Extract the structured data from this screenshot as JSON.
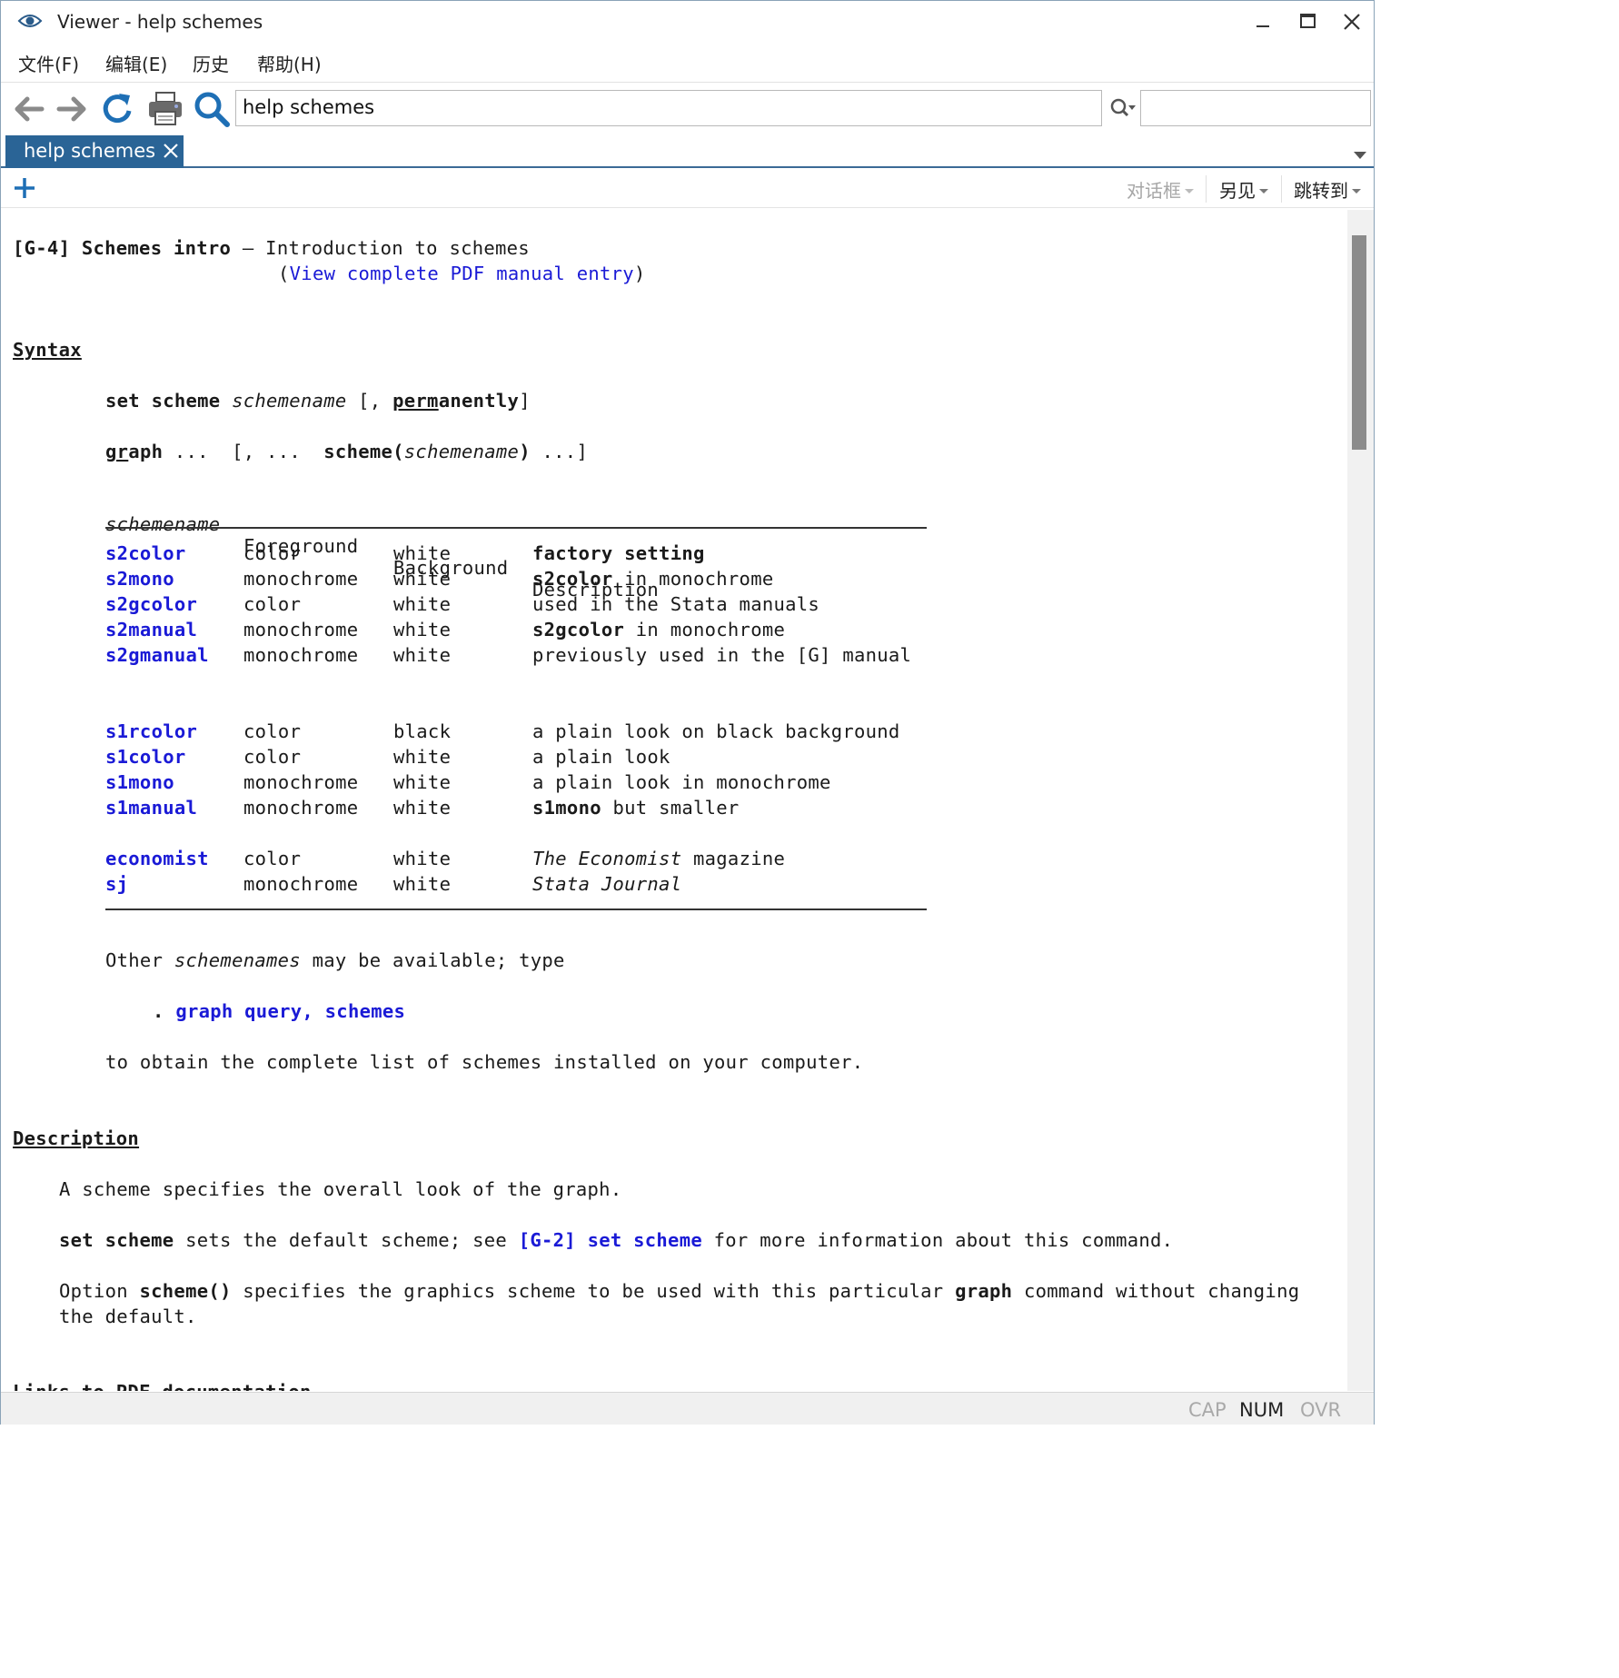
{
  "window": {
    "title": "Viewer - help schemes",
    "icon": "eye-icon"
  },
  "menu": {
    "items": [
      "文件(F)",
      "编辑(E)",
      "历史",
      "帮助(H)"
    ]
  },
  "toolbar": {
    "command_value": "help schemes",
    "find_value": ""
  },
  "tab": {
    "label": "help schemes"
  },
  "subbar": {
    "dialog_label": "对话框",
    "also_see_label": "另见",
    "jump_label": "跳转到"
  },
  "doc": {
    "header_ref": "[G-4] Schemes intro",
    "header_dash": "—",
    "header_title": "Introduction to schemes",
    "pdf_open": "(",
    "pdf_link": "View complete PDF manual entry",
    "pdf_close": ")",
    "syntax_heading": "Syntax",
    "syntax1": {
      "cmd": "set scheme",
      "arg": "schemename",
      "opt_open": "[,",
      "opt_abbr": "perm",
      "opt_rest": "anently",
      "opt_close": "]"
    },
    "syntax2": {
      "abbr": "gr",
      "rest": "aph",
      "dots1": "...",
      "opt_open": "[, ...",
      "fn": "scheme(",
      "fn_arg": "schemename",
      "fn_close": ")",
      "tail": "...]"
    },
    "table_headers": [
      "schemename",
      "Foreground",
      "Background",
      "Description"
    ],
    "table_group1": [
      {
        "name": "s2color",
        "fg": "color",
        "bg": "white",
        "desc_bold": "factory setting",
        "desc": ""
      },
      {
        "name": "s2mono",
        "fg": "monochrome",
        "bg": "white",
        "desc_bold": "s2color",
        "desc": " in monochrome"
      },
      {
        "name": "s2gcolor",
        "fg": "color",
        "bg": "white",
        "desc_bold": "",
        "desc": "used in the Stata manuals"
      },
      {
        "name": "s2manual",
        "fg": "monochrome",
        "bg": "white",
        "desc_bold": "s2gcolor",
        "desc": " in monochrome"
      },
      {
        "name": "s2gmanual",
        "fg": "monochrome",
        "bg": "white",
        "desc_bold": "",
        "desc": "previously used in the [G] manual"
      }
    ],
    "table_group2": [
      {
        "name": "s1rcolor",
        "fg": "color",
        "bg": "black",
        "desc_bold": "",
        "desc": "a plain look on black background"
      },
      {
        "name": "s1color",
        "fg": "color",
        "bg": "white",
        "desc_bold": "",
        "desc": "a plain look"
      },
      {
        "name": "s1mono",
        "fg": "monochrome",
        "bg": "white",
        "desc_bold": "",
        "desc": "a plain look in monochrome"
      },
      {
        "name": "s1manual",
        "fg": "monochrome",
        "bg": "white",
        "desc_bold": "s1mono",
        "desc": " but smaller"
      }
    ],
    "table_group3": [
      {
        "name": "economist",
        "fg": "color",
        "bg": "white",
        "desc_italic": "The Economist",
        "desc": " magazine"
      },
      {
        "name": "sj",
        "fg": "monochrome",
        "bg": "white",
        "desc_italic": "Stata Journal",
        "desc": ""
      }
    ],
    "other_pre": "Other ",
    "other_italic": "schemenames",
    "other_post": " may be available; type",
    "query_dot": ".",
    "query_link": "graph query, schemes",
    "obtain": "to obtain the complete list of schemes installed on your computer.",
    "description_heading": "Description",
    "desc1": "A scheme specifies the overall look of the graph.",
    "desc2_bold": "set scheme",
    "desc2_mid": " sets the default scheme; see ",
    "desc2_link1": "[G-2]",
    "desc2_link2": "set scheme",
    "desc2_end": " for more information about this command.",
    "desc3_pre": "Option ",
    "desc3_bold": "scheme()",
    "desc3_mid": " specifies the graphics scheme to be used with this particular ",
    "desc3_bold2": "graph",
    "desc3_end": " command without changing",
    "desc3_line2": "the default.",
    "cut_heading": "Links to PDF documentation"
  },
  "status": {
    "cap": "CAP",
    "num": "NUM",
    "ovr": "OVR"
  },
  "colors": {
    "accent": "#2a6496",
    "link": "#1a1ad6",
    "icon_blue": "#1e6fb5"
  }
}
